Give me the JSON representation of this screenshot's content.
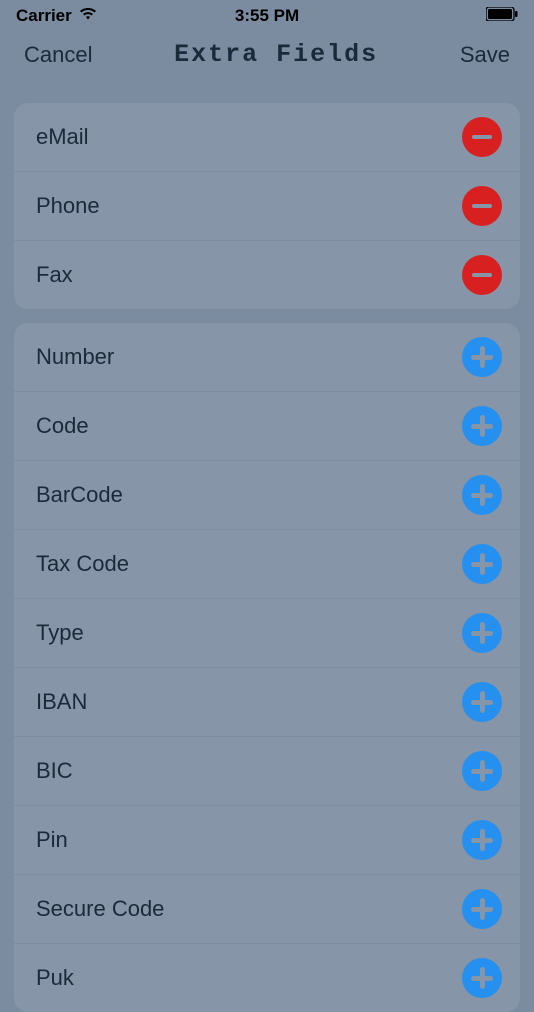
{
  "status_bar": {
    "carrier": "Carrier",
    "time": "3:55 PM"
  },
  "nav": {
    "cancel": "Cancel",
    "title": "Extra Fields",
    "save": "Save"
  },
  "active_fields": [
    {
      "label": "eMail"
    },
    {
      "label": "Phone"
    },
    {
      "label": "Fax"
    }
  ],
  "available_fields": [
    {
      "label": "Number"
    },
    {
      "label": "Code"
    },
    {
      "label": "BarCode"
    },
    {
      "label": "Tax Code"
    },
    {
      "label": "Type"
    },
    {
      "label": "IBAN"
    },
    {
      "label": "BIC"
    },
    {
      "label": "Pin"
    },
    {
      "label": "Secure Code"
    },
    {
      "label": "Puk"
    }
  ]
}
